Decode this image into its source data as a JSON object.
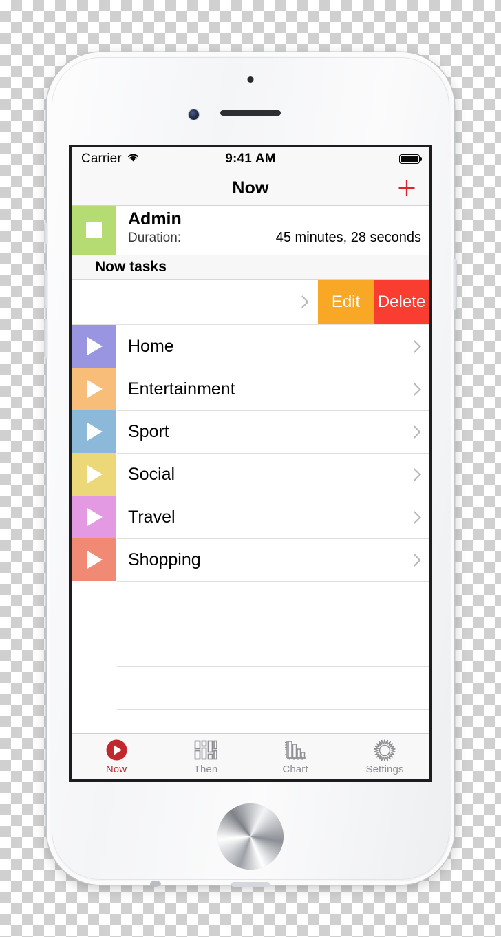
{
  "device": {
    "name": "iphone-silver",
    "hardware": {
      "sensor": "proximity-sensor",
      "camera": "front-camera",
      "speaker": "earpiece-speaker",
      "home": "home-button"
    }
  },
  "colors": {
    "accent_red": "#c1272d",
    "nav_add": "#d9252b",
    "edit_orange": "#f9a825",
    "delete_red": "#f93d31",
    "admin_tile": "#b5dc72",
    "tab_inactive": "#8e8e93",
    "separator": "#e0e0e0"
  },
  "status_bar": {
    "carrier": "Carrier",
    "wifi_icon": "wifi-icon",
    "time": "9:41 AM",
    "battery_icon": "battery-icon"
  },
  "nav_bar": {
    "title": "Now",
    "add_button": {
      "icon": "plus-icon",
      "label": "+"
    }
  },
  "header_card": {
    "tile_icon": "stop-square-icon",
    "tile_color": "#b5dc72",
    "name": "Admin",
    "duration_label": "Duration:",
    "duration_value": "45 minutes, 28 seconds"
  },
  "section": {
    "title": "Now tasks"
  },
  "swiped_row": {
    "chevron_icon": "chevron-right-icon",
    "actions": [
      {
        "label": "Edit",
        "color": "#f9a825",
        "name": "edit-button"
      },
      {
        "label": "Delete",
        "color": "#f93d31",
        "name": "delete-button"
      }
    ]
  },
  "tasks": [
    {
      "label": "Home",
      "color": "#9a95e0",
      "icon": "play-icon",
      "chevron": "chevron-right-icon"
    },
    {
      "label": "Entertainment",
      "color": "#f7bd79",
      "icon": "play-icon",
      "chevron": "chevron-right-icon"
    },
    {
      "label": "Sport",
      "color": "#8cb8d9",
      "icon": "play-icon",
      "chevron": "chevron-right-icon"
    },
    {
      "label": "Social",
      "color": "#ecd878",
      "icon": "play-icon",
      "chevron": "chevron-right-icon"
    },
    {
      "label": "Travel",
      "color": "#e39ae2",
      "icon": "play-icon",
      "chevron": "chevron-right-icon"
    },
    {
      "label": "Shopping",
      "color": "#f08a74",
      "icon": "play-icon",
      "chevron": "chevron-right-icon"
    }
  ],
  "empty_rows": 4,
  "tab_bar": {
    "items": [
      {
        "label": "Now",
        "icon": "now-play-circle-icon",
        "active": true
      },
      {
        "label": "Then",
        "icon": "schedule-grid-icon",
        "active": false
      },
      {
        "label": "Chart",
        "icon": "bar-chart-icon",
        "active": false
      },
      {
        "label": "Settings",
        "icon": "gear-sun-icon",
        "active": false
      }
    ]
  }
}
